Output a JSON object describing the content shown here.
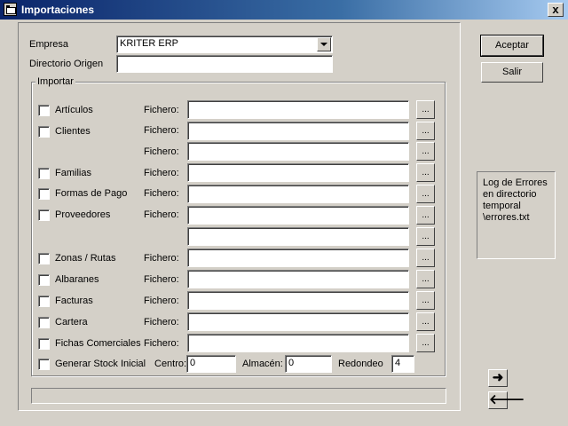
{
  "window": {
    "title": "Importaciones",
    "close": "x"
  },
  "empresa": {
    "label": "Empresa",
    "value": "KRITER ERP"
  },
  "directorio": {
    "label": "Directorio Origen",
    "value": ""
  },
  "importar": {
    "label": "Importar"
  },
  "fichero_label": "Fichero:",
  "browse_label": "...",
  "rows": [
    {
      "label": "Artículos"
    },
    {
      "label": "Clientes"
    },
    {
      "label": "Familias"
    },
    {
      "label": "Formas de Pago"
    },
    {
      "label": "Proveedores"
    },
    {
      "label": "Zonas / Rutas"
    },
    {
      "label": "Albaranes"
    },
    {
      "label": "Facturas"
    },
    {
      "label": "Cartera"
    },
    {
      "label": "Fichas Comerciales"
    }
  ],
  "stock": {
    "label": "Generar Stock Inicial",
    "centro_label": "Centro:",
    "centro_value": "0",
    "almacen_label": "Almacén:",
    "almacen_value": "0",
    "redondeo_label": "Redondeo",
    "redondeo_value": "4"
  },
  "buttons": {
    "aceptar": "Aceptar",
    "salir": "Salir"
  },
  "log": {
    "text": "Log de Errores en directorio temporal \\errores.txt"
  },
  "nav": {
    "next_icon": "arrow-right-icon",
    "prev_icon": "arrow-left-icon"
  }
}
